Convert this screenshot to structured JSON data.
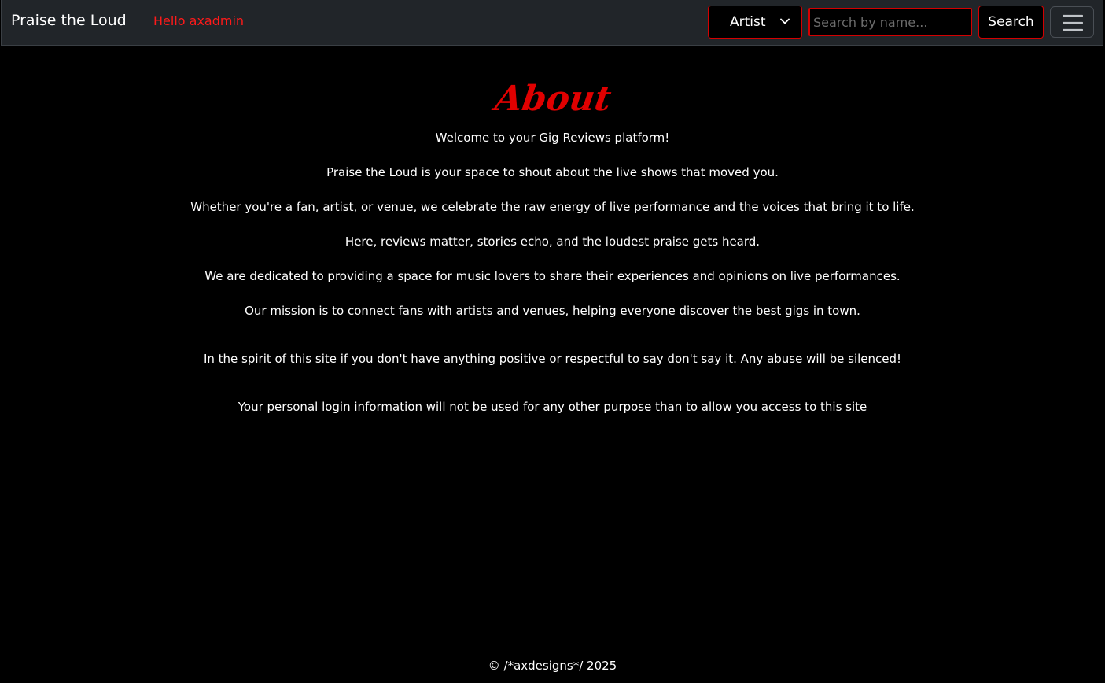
{
  "navbar": {
    "brand": "Praise the Loud",
    "greeting": "Hello axadmin",
    "filter_select": {
      "selected": "Artist"
    },
    "search": {
      "placeholder": "Search by name...",
      "value": ""
    },
    "search_button_label": "Search",
    "menu_icon": "hamburger-icon"
  },
  "main": {
    "title": "About",
    "paragraphs": [
      "Welcome to your Gig Reviews platform!",
      "Praise the Loud is your space to shout about the live shows that moved you.",
      "Whether you're a fan, artist, or venue, we celebrate the raw energy of live performance and the voices that bring it to life.",
      "Here, reviews matter, stories echo, and the loudest praise gets heard.",
      "We are dedicated to providing a space for music lovers to share their experiences and opinions on live performances.",
      "Our mission is to connect fans with artists and venues, helping everyone discover the best gigs in town."
    ],
    "notice": "In the spirit of this site if you don't have anything positive or respectful to say don't say it. Any abuse will be silenced!",
    "privacy": "Your personal login information will not be used for any other purpose than to allow you access to this site"
  },
  "footer": {
    "copyright": "© /*axdesigns*/ 2025"
  },
  "colors": {
    "accent": "#ff1a1a",
    "navbar_bg": "#212529",
    "page_bg": "#000000"
  }
}
